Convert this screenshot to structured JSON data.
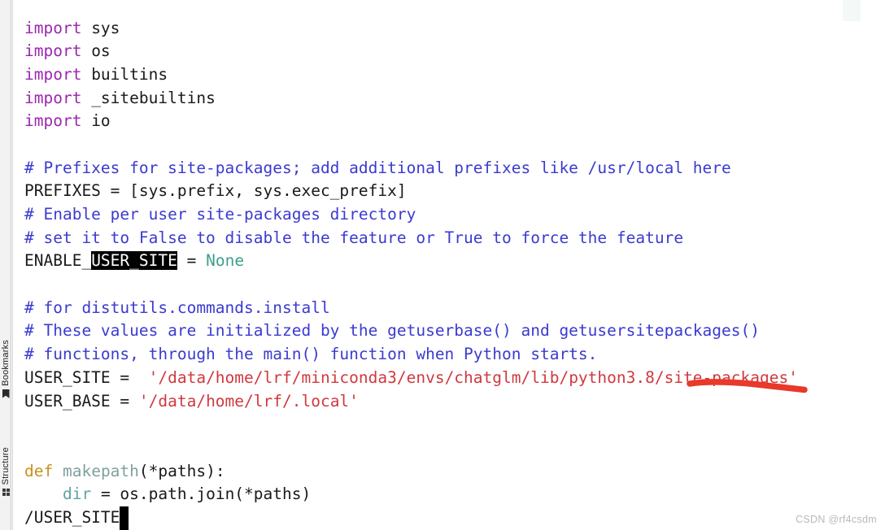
{
  "app": {
    "type": "code-editor",
    "language": "Python",
    "background": "#ffffff"
  },
  "tool_strip": {
    "items": [
      {
        "label": "Bookmarks",
        "icon": "bookmark-icon"
      },
      {
        "label": "Structure",
        "icon": "grid-icon"
      }
    ]
  },
  "editor": {
    "selection_text": "USER_SITE",
    "caret_after": "/USER_SITE",
    "lines": [
      {
        "n": 1,
        "tokens": [
          {
            "t": "import",
            "c": "kw"
          },
          {
            "t": " sys",
            "c": "plain"
          }
        ]
      },
      {
        "n": 2,
        "tokens": [
          {
            "t": "import",
            "c": "kw"
          },
          {
            "t": " os",
            "c": "plain"
          }
        ]
      },
      {
        "n": 3,
        "tokens": [
          {
            "t": "import",
            "c": "kw"
          },
          {
            "t": " builtins",
            "c": "plain"
          }
        ]
      },
      {
        "n": 4,
        "tokens": [
          {
            "t": "import",
            "c": "kw"
          },
          {
            "t": " _sitebuiltins",
            "c": "plain"
          }
        ]
      },
      {
        "n": 5,
        "tokens": [
          {
            "t": "import",
            "c": "kw"
          },
          {
            "t": " io",
            "c": "plain"
          }
        ]
      },
      {
        "n": 6,
        "tokens": []
      },
      {
        "n": 7,
        "tokens": [
          {
            "t": "# Prefixes for site-packages; add additional prefixes like /usr/local here",
            "c": "com"
          }
        ]
      },
      {
        "n": 8,
        "tokens": [
          {
            "t": "PREFIXES = [sys.prefix, sys.exec_prefix]",
            "c": "plain"
          }
        ]
      },
      {
        "n": 9,
        "tokens": [
          {
            "t": "# Enable per user site-packages directory",
            "c": "com"
          }
        ]
      },
      {
        "n": 10,
        "tokens": [
          {
            "t": "# set it to False to disable the feature or True to force the feature",
            "c": "com"
          }
        ]
      },
      {
        "n": 11,
        "tokens": [
          {
            "t": "ENABLE_",
            "c": "plain"
          },
          {
            "t": "USER_SITE",
            "c": "sel"
          },
          {
            "t": " = ",
            "c": "plain"
          },
          {
            "t": "None",
            "c": "con"
          }
        ]
      },
      {
        "n": 12,
        "tokens": []
      },
      {
        "n": 13,
        "tokens": [
          {
            "t": "# for distutils.commands.install",
            "c": "com"
          }
        ]
      },
      {
        "n": 14,
        "tokens": [
          {
            "t": "# These values are initialized by the getuserbase() and getusersitepackages()",
            "c": "com"
          }
        ]
      },
      {
        "n": 15,
        "tokens": [
          {
            "t": "# functions, through the main() function when Python starts.",
            "c": "com"
          }
        ]
      },
      {
        "n": 16,
        "tokens": [
          {
            "t": "USER_SITE = ",
            "c": "plain"
          },
          {
            "t": " '/data/home/lrf/miniconda3/envs/chatglm/lib/python3.8/site-packages'",
            "c": "str"
          }
        ]
      },
      {
        "n": 17,
        "tokens": [
          {
            "t": "USER_BASE = ",
            "c": "plain"
          },
          {
            "t": "'/data/home/lrf/.local'",
            "c": "str"
          }
        ]
      },
      {
        "n": 18,
        "tokens": []
      },
      {
        "n": 19,
        "tokens": []
      },
      {
        "n": 20,
        "tokens": [
          {
            "t": "def",
            "c": "def"
          },
          {
            "t": " ",
            "c": "plain"
          },
          {
            "t": "makepath",
            "c": "fn"
          },
          {
            "t": "(*paths):",
            "c": "plain"
          }
        ]
      },
      {
        "n": 21,
        "tokens": [
          {
            "t": "    ",
            "c": "plain"
          },
          {
            "t": "dir",
            "c": "var"
          },
          {
            "t": " = os.path.join(*paths)",
            "c": "plain"
          }
        ]
      },
      {
        "n": 22,
        "tokens": [
          {
            "t": "/USER_SITE",
            "c": "plain"
          },
          {
            "t": " ",
            "c": "caret"
          }
        ]
      }
    ]
  },
  "annotation": {
    "type": "freehand-underline",
    "color": "#e8392a",
    "target_text": "site-packages"
  },
  "watermark": {
    "text": "CSDN @rf4csdm"
  },
  "colors": {
    "keyword": "#9c27b0",
    "comment": "#3b3bd0",
    "string": "#d0393e",
    "constant": "#3f9e8e",
    "def_keyword": "#c9911b",
    "function_name": "#80a0a0",
    "variable": "#5fa3a3",
    "plain_text": "#1a1a1a",
    "selection_bg": "#000000",
    "annotation_red": "#e8392a",
    "watermark": "#b9b9b9"
  }
}
